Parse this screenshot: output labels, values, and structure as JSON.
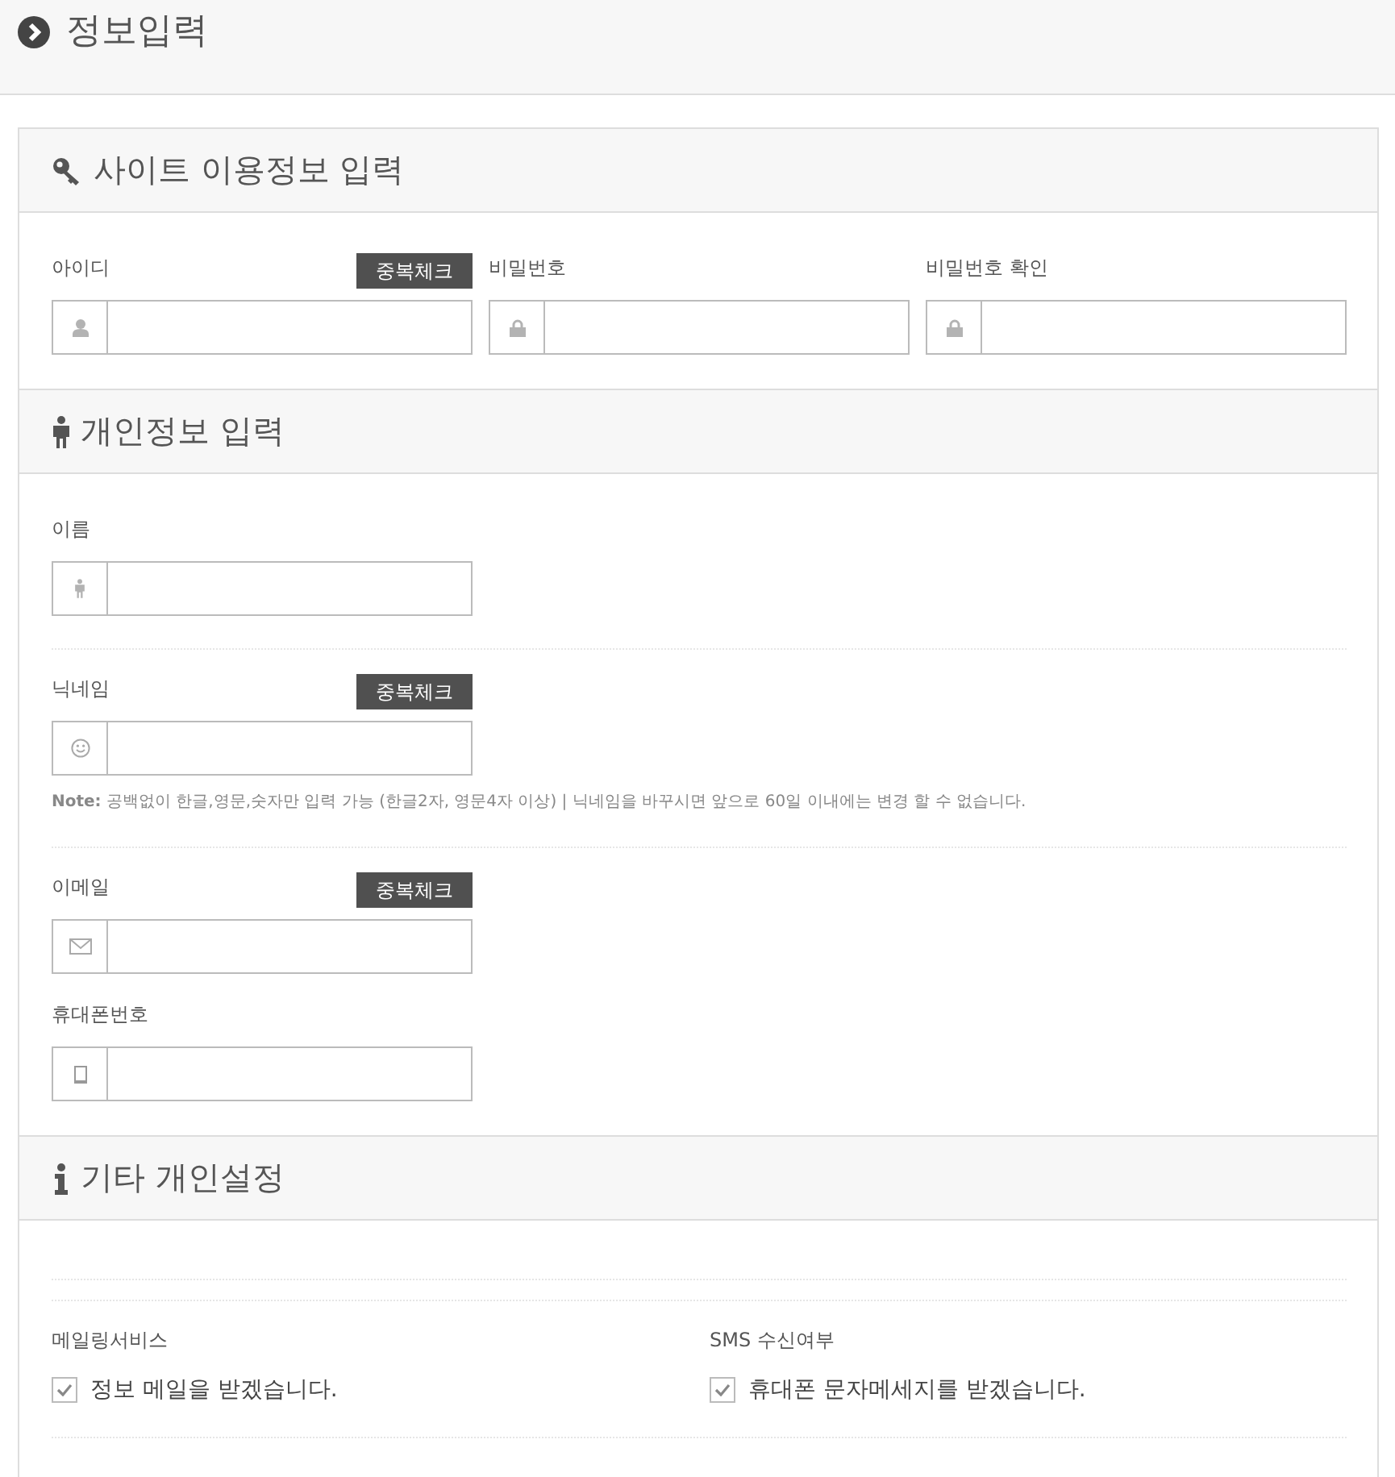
{
  "page_title": "정보입력",
  "sections": [
    {
      "title": "사이트 이용정보 입력",
      "rows": [
        {
          "kind": "fields",
          "fields": [
            {
              "kind": "id",
              "label": "아이디",
              "button": "중복체크"
            },
            {
              "kind": "password",
              "label": "비밀번호"
            },
            {
              "kind": "password",
              "label": "비밀번호 확인"
            }
          ]
        }
      ]
    },
    {
      "title": "개인정보 입력",
      "rows": [
        {
          "kind": "fields",
          "fields": [
            {
              "kind": "name",
              "label": "이름"
            }
          ]
        },
        {
          "kind": "rule"
        },
        {
          "kind": "fields",
          "fields": [
            {
              "kind": "nickname",
              "label": "닉네임",
              "button": "중복체크",
              "note": "**Note:** 공백없이 한글,영문,숫자만 입력 가능 (한글2자, 영문4자 이상) | 닉네임을 바꾸시면 앞으로 60일 이내에는 변경 할 수 없습니다."
            }
          ]
        },
        {
          "kind": "rule"
        },
        {
          "kind": "fields",
          "fields": [
            {
              "kind": "email",
              "label": "이메일",
              "button": "중복체크"
            }
          ]
        },
        {
          "kind": "fields",
          "fields": [
            {
              "kind": "phone",
              "label": "휴대폰번호"
            }
          ]
        }
      ]
    },
    {
      "title": "기타 개인설정",
      "rows": [
        {
          "kind": "rule"
        },
        {
          "kind": "rule"
        },
        {
          "kind": "checks",
          "items": [
            {
              "label": "메일링서비스",
              "text": "정보 메일을 받겠습니다.",
              "checked": true
            },
            {
              "label": "SMS 수신여부",
              "text": "휴대폰 문자메세지를 받겠습니다.",
              "checked": true
            }
          ]
        },
        {
          "kind": "rule"
        }
      ]
    }
  ]
}
